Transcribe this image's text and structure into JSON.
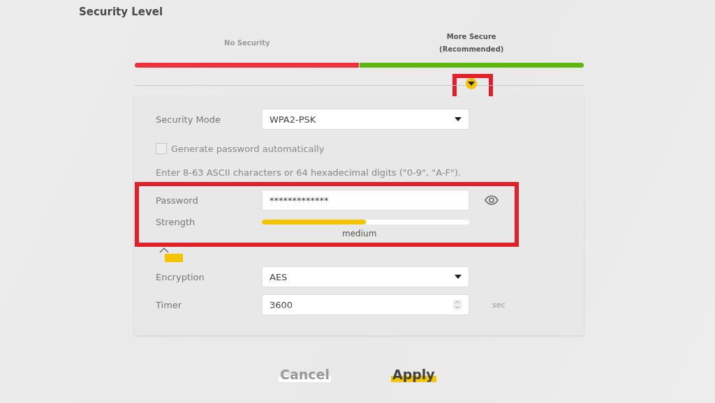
{
  "title": "Security Level",
  "levels": [
    {
      "label": "No Security",
      "selected": false,
      "color": "#f0303c"
    },
    {
      "label": "More Secure\n(Recommended)",
      "selected": true,
      "color": "#5cb80c"
    }
  ],
  "form": {
    "security_mode": {
      "label": "Security Mode",
      "value": "WPA2-PSK"
    },
    "generate_password": {
      "label": "Generate password automatically",
      "checked": false
    },
    "hint": "Enter 8-63 ASCII characters or 64 hexadecimal digits (\"0-9\", \"A-F\").",
    "password": {
      "label": "Password",
      "value": "*************"
    },
    "strength": {
      "label": "Strength",
      "level": 0.5,
      "reading": "medium"
    },
    "encryption": {
      "label": "Encryption",
      "value": "AES"
    },
    "timer": {
      "label": "Timer",
      "value": "3600",
      "unit": "sec"
    }
  },
  "buttons": [
    {
      "label": "Cancel",
      "kind": "secondary"
    },
    {
      "label": "Apply",
      "kind": "primary"
    }
  ]
}
